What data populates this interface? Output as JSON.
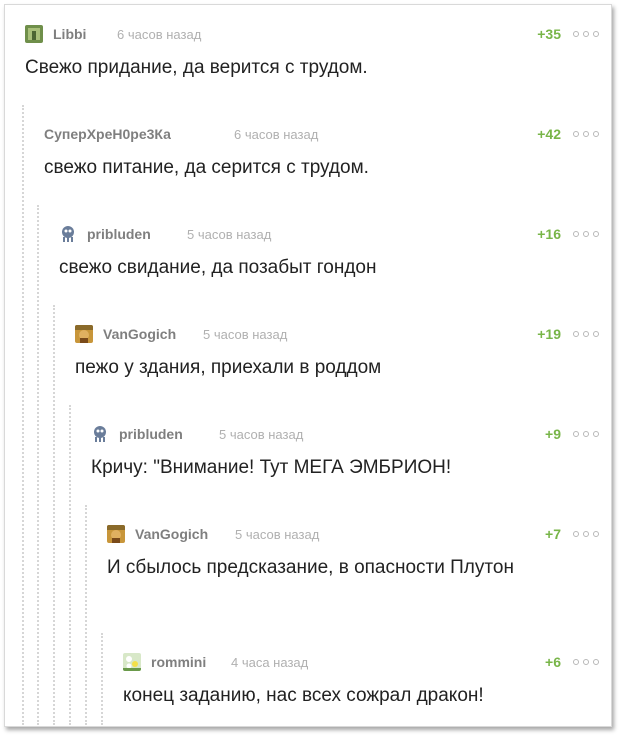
{
  "comments": [
    {
      "author": "Libbi",
      "time": "6 часов назад",
      "score": "+35",
      "avatar_icon": "avatar-libbi-icon",
      "text": "Свежо придание, да верится с трудом."
    },
    {
      "author": "СуперХреН0ре3Ка",
      "time": "6 часов назад",
      "score": "+42",
      "avatar_icon": "",
      "text": "свежо питание, да серится с трудом."
    },
    {
      "author": "pribluden",
      "time": "5 часов назад",
      "score": "+16",
      "avatar_icon": "avatar-pribluden-icon",
      "text": "свежо свидание, да позабыт гондон"
    },
    {
      "author": "VanGogich",
      "time": "5 часов назад",
      "score": "+19",
      "avatar_icon": "avatar-vangogich-icon",
      "text": "пежо у здания, приехали в роддом"
    },
    {
      "author": "pribluden",
      "time": "5 часов назад",
      "score": "+9",
      "avatar_icon": "avatar-pribluden-icon",
      "text": "Кричу: \"Внимание! Тут МЕГА ЭМБРИОН!"
    },
    {
      "author": "VanGogich",
      "time": "5 часов назад",
      "score": "+7",
      "avatar_icon": "avatar-vangogich-icon",
      "text": "И сбылось предсказание, в опасности Плутон"
    },
    {
      "author": "rommini",
      "time": "4 часа назад",
      "score": "+6",
      "avatar_icon": "avatar-rommini-icon",
      "text": "конец заданию, нас всех сожрал дракон!"
    }
  ],
  "colors": {
    "score": "#78b548",
    "author": "#7f7f7f",
    "time": "#b0b0b0",
    "text": "#222222"
  },
  "more_icon": "more-options-icon"
}
